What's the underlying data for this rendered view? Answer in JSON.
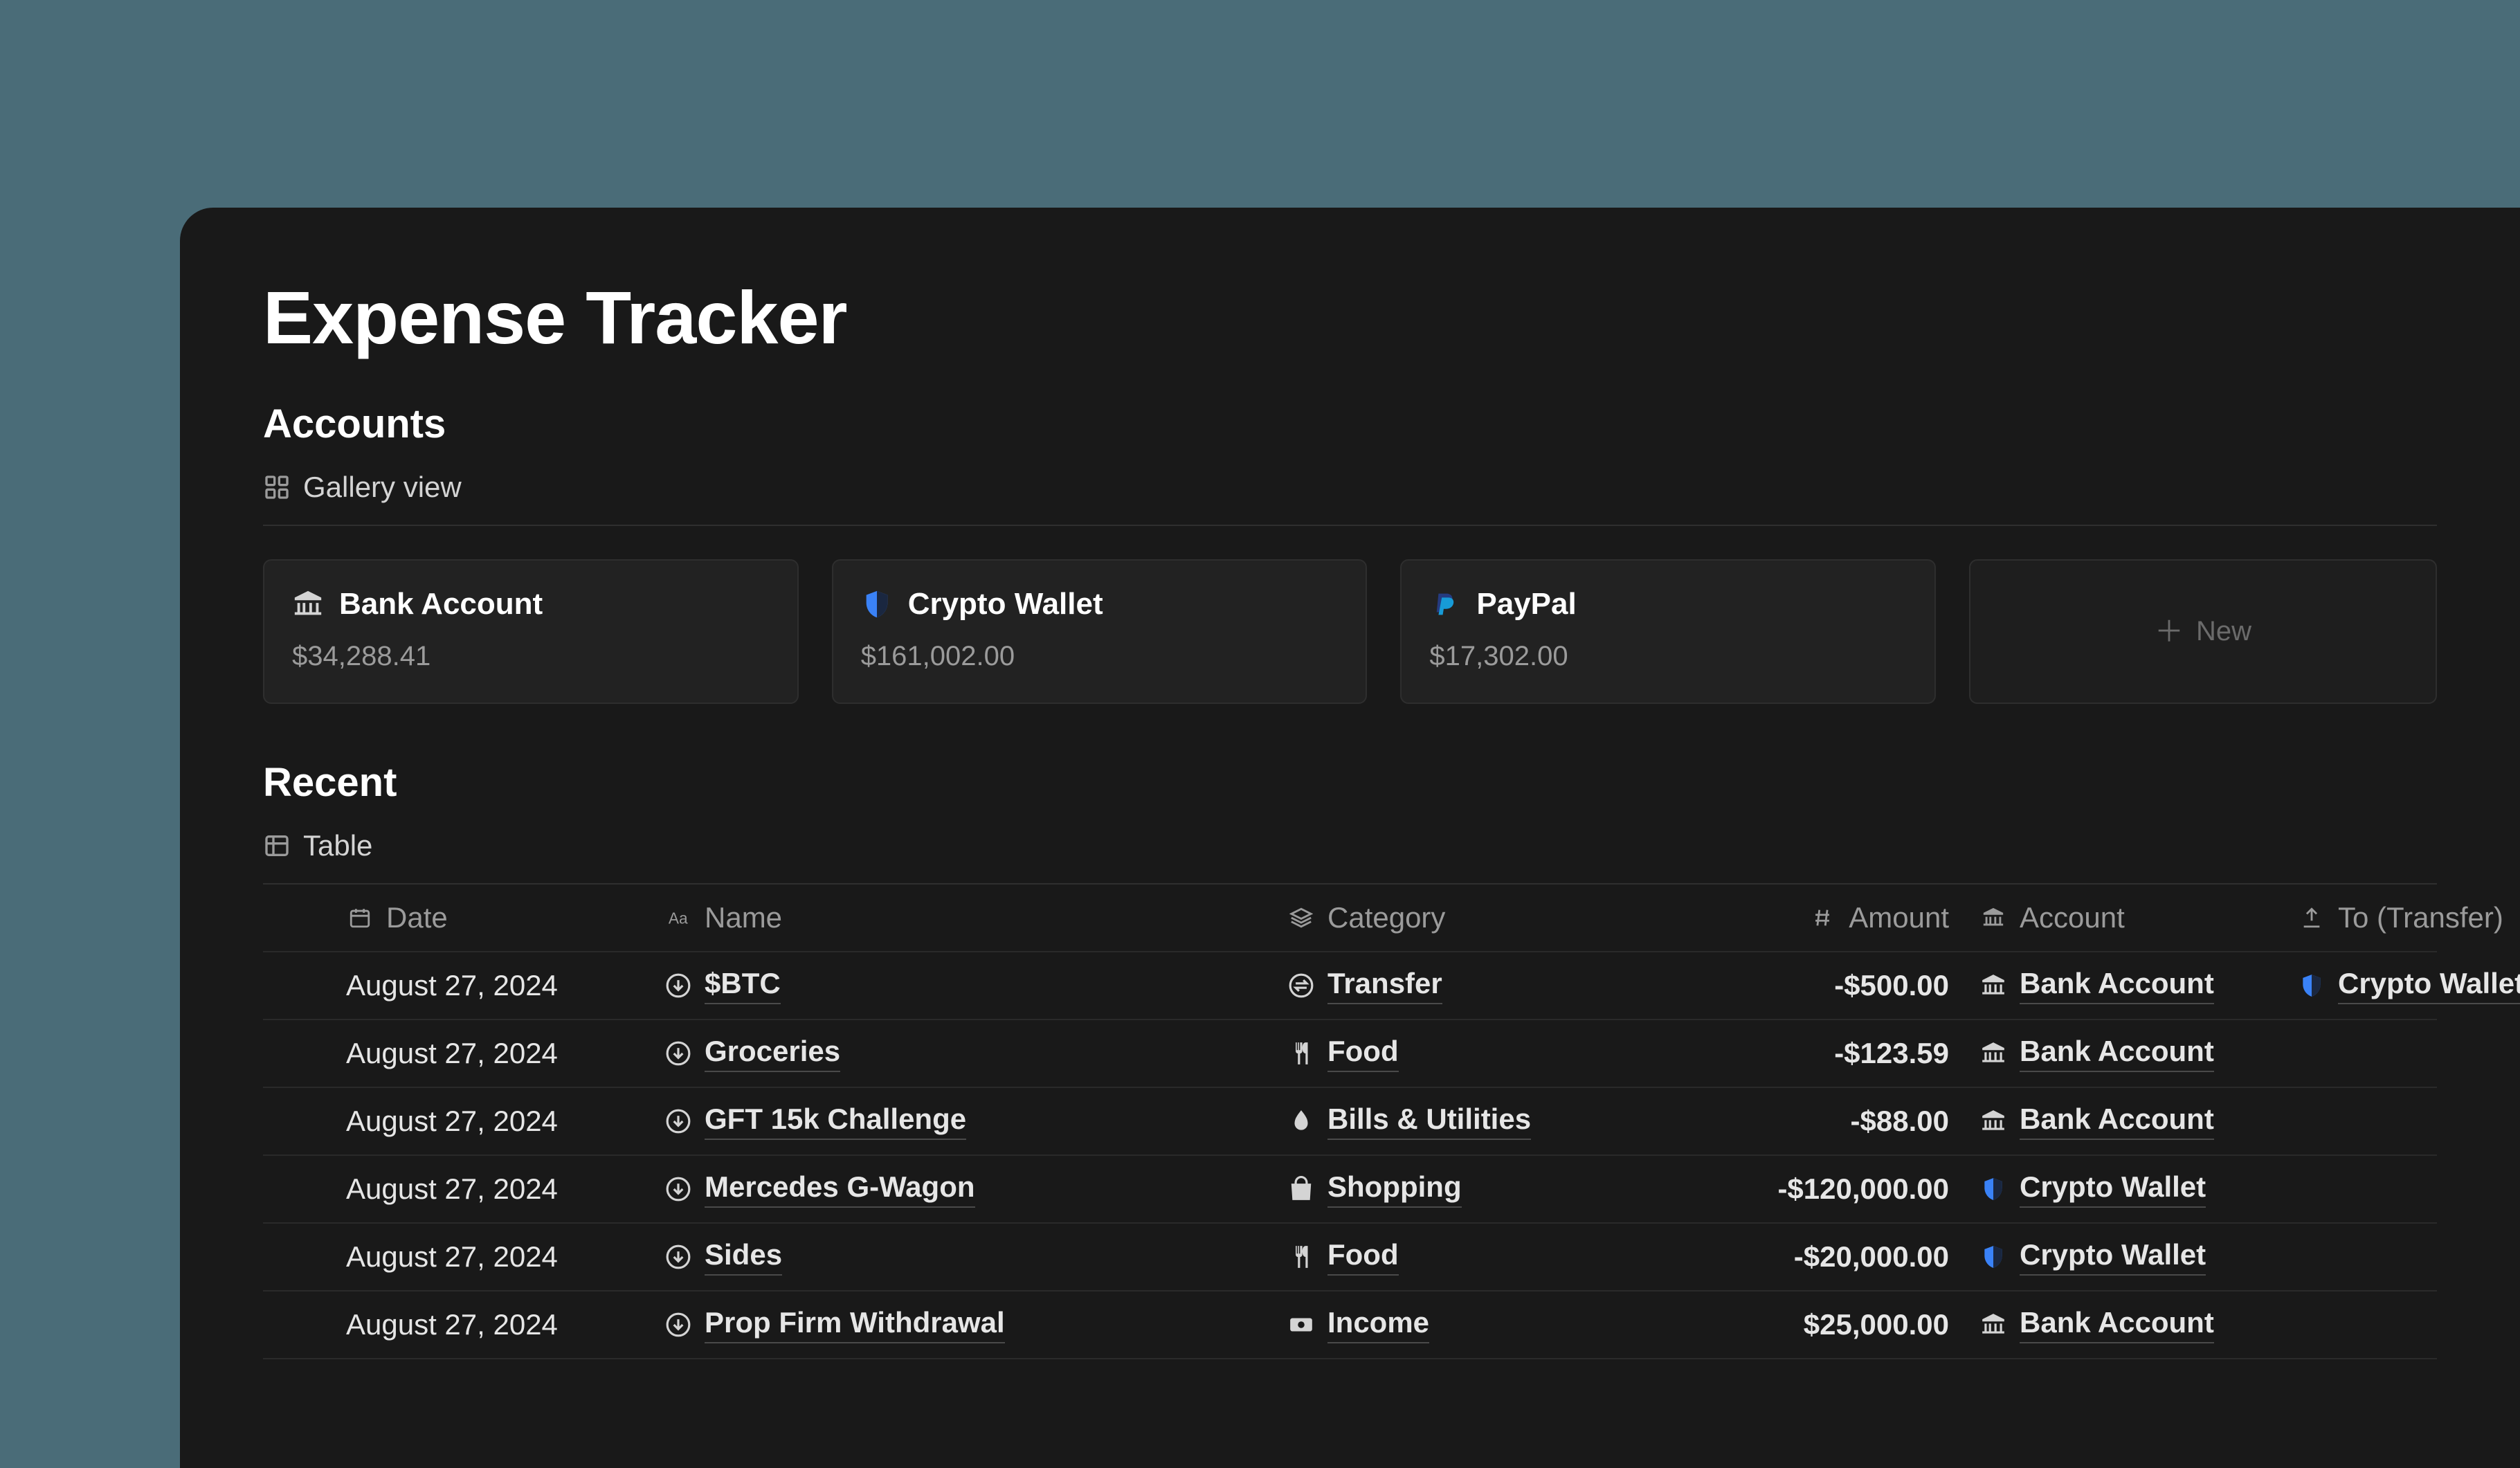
{
  "page": {
    "title": "Expense Tracker"
  },
  "accounts_section": {
    "heading": "Accounts",
    "view_label": "Gallery view",
    "new_label": "New",
    "cards": [
      {
        "icon": "bank",
        "name": "Bank Account",
        "balance": "$34,288.41"
      },
      {
        "icon": "shield",
        "name": "Crypto Wallet",
        "balance": "$161,002.00"
      },
      {
        "icon": "paypal",
        "name": "PayPal",
        "balance": "$17,302.00"
      }
    ]
  },
  "recent_section": {
    "heading": "Recent",
    "view_label": "Table",
    "columns": {
      "date": "Date",
      "name": "Name",
      "category": "Category",
      "amount": "Amount",
      "account": "Account",
      "to_transfer": "To (Transfer)"
    },
    "rows": [
      {
        "date": "August 27, 2024",
        "name": "$BTC",
        "category_icon": "transfer",
        "category": "Transfer",
        "amount": "-$500.00",
        "account_icon": "bank",
        "account": "Bank Account",
        "to_icon": "shield",
        "to": "Crypto Wallet"
      },
      {
        "date": "August 27, 2024",
        "name": "Groceries",
        "category_icon": "food",
        "category": "Food",
        "amount": "-$123.59",
        "account_icon": "bank",
        "account": "Bank Account",
        "to_icon": "",
        "to": ""
      },
      {
        "date": "August 27, 2024",
        "name": "GFT 15k Challenge",
        "category_icon": "bills",
        "category": "Bills & Utilities",
        "amount": "-$88.00",
        "account_icon": "bank",
        "account": "Bank Account",
        "to_icon": "",
        "to": ""
      },
      {
        "date": "August 27, 2024",
        "name": "Mercedes G-Wagon",
        "category_icon": "shopping",
        "category": "Shopping",
        "amount": "-$120,000.00",
        "account_icon": "shield",
        "account": "Crypto Wallet",
        "to_icon": "",
        "to": ""
      },
      {
        "date": "August 27, 2024",
        "name": "Sides",
        "category_icon": "food",
        "category": "Food",
        "amount": "-$20,000.00",
        "account_icon": "shield",
        "account": "Crypto Wallet",
        "to_icon": "",
        "to": ""
      },
      {
        "date": "August 27, 2024",
        "name": "Prop Firm Withdrawal",
        "category_icon": "income",
        "category": "Income",
        "amount": "$25,000.00",
        "account_icon": "bank",
        "account": "Bank Account",
        "to_icon": "",
        "to": ""
      }
    ]
  },
  "icons": {
    "bank": "bank-icon",
    "shield": "shield-icon",
    "paypal": "paypal-icon"
  }
}
